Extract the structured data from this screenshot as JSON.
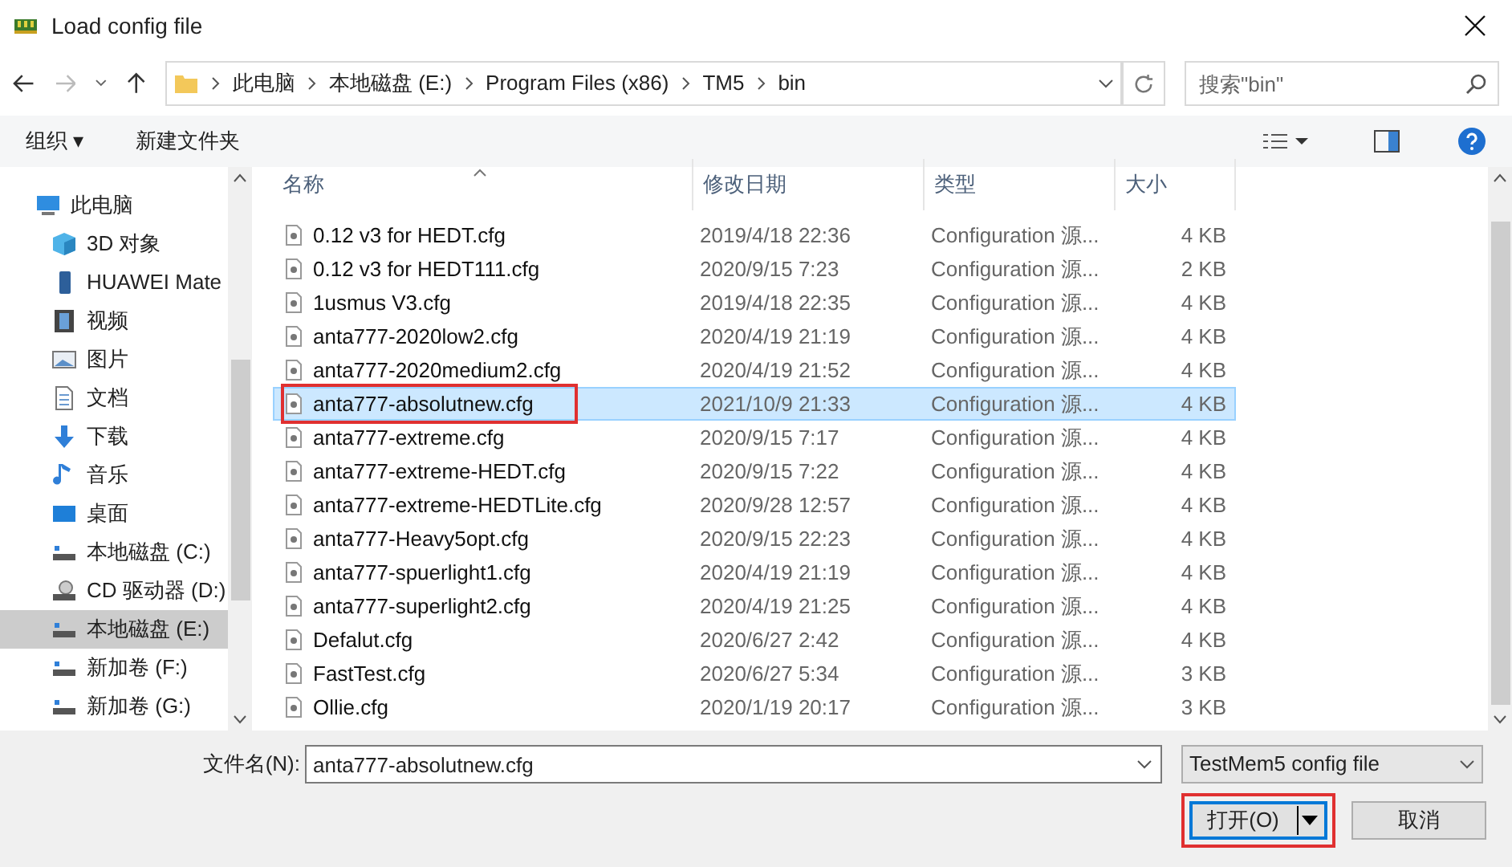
{
  "window": {
    "title": "Load config file"
  },
  "address_bar": {
    "path": [
      "此电脑",
      "本地磁盘 (E:)",
      "Program Files (x86)",
      "TM5",
      "bin"
    ]
  },
  "search": {
    "placeholder": "搜索\"bin\""
  },
  "toolbar": {
    "organize": "组织 ▾",
    "new_folder": "新建文件夹"
  },
  "sidebar": {
    "items": [
      {
        "label": "此电脑",
        "kind": "pc",
        "selected": false
      },
      {
        "label": "3D 对象",
        "kind": "cube",
        "selected": false
      },
      {
        "label": "HUAWEI Mate",
        "kind": "phone",
        "selected": false
      },
      {
        "label": "视频",
        "kind": "video",
        "selected": false
      },
      {
        "label": "图片",
        "kind": "image",
        "selected": false
      },
      {
        "label": "文档",
        "kind": "doc",
        "selected": false
      },
      {
        "label": "下载",
        "kind": "download",
        "selected": false
      },
      {
        "label": "音乐",
        "kind": "music",
        "selected": false
      },
      {
        "label": "桌面",
        "kind": "desktop",
        "selected": false
      },
      {
        "label": "本地磁盘 (C:)",
        "kind": "drive",
        "selected": false
      },
      {
        "label": "CD 驱动器 (D:)",
        "kind": "cd",
        "selected": false
      },
      {
        "label": "本地磁盘 (E:)",
        "kind": "drive",
        "selected": true
      },
      {
        "label": "新加卷 (F:)",
        "kind": "drive",
        "selected": false
      },
      {
        "label": "新加卷 (G:)",
        "kind": "drive",
        "selected": false
      }
    ]
  },
  "table": {
    "columns": [
      "名称",
      "修改日期",
      "类型",
      "大小"
    ],
    "rows": [
      {
        "name": "0.12 v3 for HEDT.cfg",
        "date": "2019/4/18 22:36",
        "type": "Configuration 源...",
        "size": "4 KB",
        "selected": false,
        "annotated": false
      },
      {
        "name": "0.12 v3 for HEDT111.cfg",
        "date": "2020/9/15 7:23",
        "type": "Configuration 源...",
        "size": "2 KB",
        "selected": false,
        "annotated": false
      },
      {
        "name": "1usmus V3.cfg",
        "date": "2019/4/18 22:35",
        "type": "Configuration 源...",
        "size": "4 KB",
        "selected": false,
        "annotated": false
      },
      {
        "name": "anta777-2020low2.cfg",
        "date": "2020/4/19 21:19",
        "type": "Configuration 源...",
        "size": "4 KB",
        "selected": false,
        "annotated": false
      },
      {
        "name": "anta777-2020medium2.cfg",
        "date": "2020/4/19 21:52",
        "type": "Configuration 源...",
        "size": "4 KB",
        "selected": false,
        "annotated": false
      },
      {
        "name": "anta777-absolutnew.cfg",
        "date": "2021/10/9 21:33",
        "type": "Configuration 源...",
        "size": "4 KB",
        "selected": true,
        "annotated": true
      },
      {
        "name": "anta777-extreme.cfg",
        "date": "2020/9/15 7:17",
        "type": "Configuration 源...",
        "size": "4 KB",
        "selected": false,
        "annotated": false
      },
      {
        "name": "anta777-extreme-HEDT.cfg",
        "date": "2020/9/15 7:22",
        "type": "Configuration 源...",
        "size": "4 KB",
        "selected": false,
        "annotated": false
      },
      {
        "name": "anta777-extreme-HEDTLite.cfg",
        "date": "2020/9/28 12:57",
        "type": "Configuration 源...",
        "size": "4 KB",
        "selected": false,
        "annotated": false
      },
      {
        "name": "anta777-Heavy5opt.cfg",
        "date": "2020/9/15 22:23",
        "type": "Configuration 源...",
        "size": "4 KB",
        "selected": false,
        "annotated": false
      },
      {
        "name": "anta777-spuerlight1.cfg",
        "date": "2020/4/19 21:19",
        "type": "Configuration 源...",
        "size": "4 KB",
        "selected": false,
        "annotated": false
      },
      {
        "name": "anta777-superlight2.cfg",
        "date": "2020/4/19 21:25",
        "type": "Configuration 源...",
        "size": "4 KB",
        "selected": false,
        "annotated": false
      },
      {
        "name": "Defalut.cfg",
        "date": "2020/6/27 2:42",
        "type": "Configuration 源...",
        "size": "4 KB",
        "selected": false,
        "annotated": false
      },
      {
        "name": "FastTest.cfg",
        "date": "2020/6/27 5:34",
        "type": "Configuration 源...",
        "size": "3 KB",
        "selected": false,
        "annotated": false
      },
      {
        "name": "Ollie.cfg",
        "date": "2020/1/19 20:17",
        "type": "Configuration 源...",
        "size": "3 KB",
        "selected": false,
        "annotated": false
      }
    ]
  },
  "footer": {
    "filename_label": "文件名(N):",
    "filename": "anta777-absolutnew.cfg",
    "filter": "TestMem5 config file",
    "open_button": {
      "label": "打开(O)",
      "annotated": true
    },
    "cancel_button": "取消"
  }
}
